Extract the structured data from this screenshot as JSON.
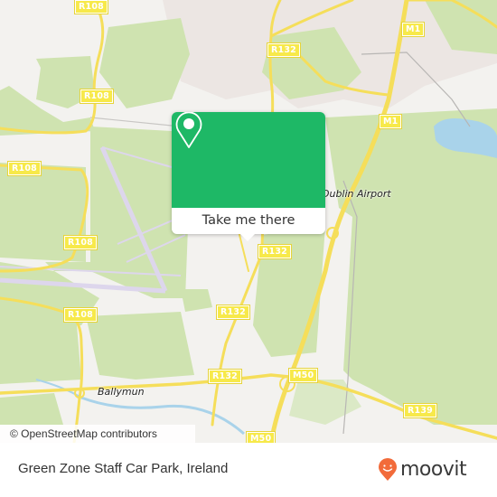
{
  "map": {
    "road_labels": [
      {
        "id": "r108-top",
        "text": "R108"
      },
      {
        "id": "r108-a",
        "text": "R108"
      },
      {
        "id": "r108-b",
        "text": "R108"
      },
      {
        "id": "r108-c",
        "text": "R108"
      },
      {
        "id": "r108-d",
        "text": "R108"
      },
      {
        "id": "r132-top",
        "text": "R132"
      },
      {
        "id": "r132-b",
        "text": "R132"
      },
      {
        "id": "r132-c",
        "text": "R132"
      },
      {
        "id": "r132-d",
        "text": "R132"
      },
      {
        "id": "m1-top",
        "text": "M1"
      },
      {
        "id": "m1-b",
        "text": "M1"
      },
      {
        "id": "m50-a",
        "text": "M50"
      },
      {
        "id": "m50-b",
        "text": "M50"
      },
      {
        "id": "r139",
        "text": "R139"
      }
    ],
    "place_labels": {
      "airport": "Dublin Airport",
      "ballymun": "Ballymun"
    },
    "attribution": "© OpenStreetMap contributors"
  },
  "popup": {
    "action_label": "Take me there",
    "icon": "map-pin-icon",
    "color": "#1eb866"
  },
  "footer": {
    "location_title": "Green Zone Staff Car Park, Ireland",
    "brand_name": "moovit",
    "brand_color": "#f26b3a"
  }
}
